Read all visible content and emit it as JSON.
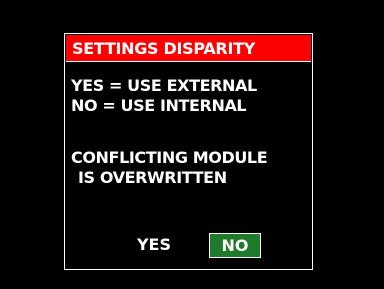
{
  "dialog": {
    "title": "SETTINGS DISPARITY",
    "lines": [
      "YES = USE EXTERNAL",
      "NO = USE INTERNAL",
      "CONFLICTING MODULE",
      "IS OVERWRITTEN"
    ],
    "buttons": {
      "yes_label": "YES",
      "no_label": "NO",
      "selected": "NO"
    }
  },
  "colors": {
    "background": "#000000",
    "title_bar": "#ff0000",
    "selected_button": "#1f7a2b",
    "text": "#ffffff"
  }
}
